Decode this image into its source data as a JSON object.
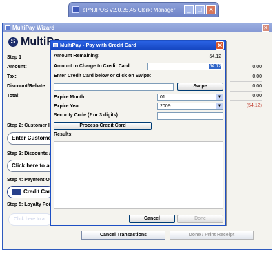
{
  "app": {
    "title": "ePNJPOS V2.0.25.45 Clerk: Manager"
  },
  "wizard": {
    "title": "MultiPay Wizard",
    "brand": "MultiPa",
    "step1": "Step 1",
    "rows": [
      {
        "label": "Amount:",
        "value": "0.00"
      },
      {
        "label": "Tax:",
        "value": "0.00"
      },
      {
        "label": "Discount/Rebate:",
        "value": "0.00"
      },
      {
        "label": "Total:",
        "value": "0.00"
      }
    ],
    "remaining_value": "(54.12)",
    "step2": "Step 2: Customer Inf",
    "customer_btn": "Enter Customer",
    "step3": "Step 3: Discounts / R",
    "discount_btn": "Click here to ap",
    "step4": "Step 4: Payment Opt",
    "card_btn": "Credit Card",
    "step5": "Step 5: Loyalty Point",
    "loyalty_placeholder": "Click here to a",
    "cancel_tx": "Cancel Transactions",
    "done_print": "Done / Print Receipt"
  },
  "dialog": {
    "title": "MultiPay - Pay with Credit Card",
    "amount_remaining_label": "Amount Remaining:",
    "amount_remaining_value": "54.12",
    "amount_charge_label": "Amount to Charge to Credit Card:",
    "amount_charge_value": "54.12",
    "swipe_instruction": "Enter Credit Card below or click on Swipe:",
    "swipe_btn": "Swipe",
    "expire_month_label": "Expire Month:",
    "expire_month_value": "01",
    "expire_year_label": "Expire Year:",
    "expire_year_value": "2009",
    "security_label": "Security Code (2 or 3 digits):",
    "process_btn": "Process Credit Card",
    "results_label": "Results:",
    "cancel_btn": "Cancel",
    "done_btn": "Done"
  }
}
